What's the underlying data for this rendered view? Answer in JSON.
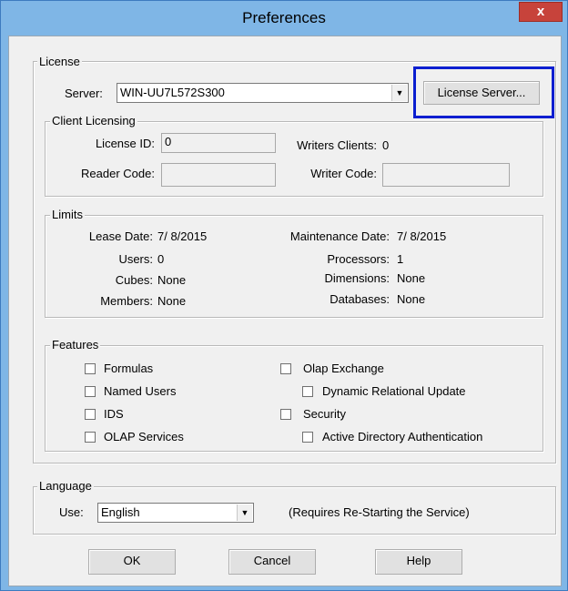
{
  "window": {
    "title": "Preferences",
    "close_label": "x"
  },
  "license": {
    "legend": "License",
    "server_label": "Server:",
    "server_value": "WIN-UU7L572S300",
    "license_server_button": "License Server..."
  },
  "client_licensing": {
    "legend": "Client Licensing",
    "license_id_label": "License ID:",
    "license_id_value": "0",
    "writers_clients_label": "Writers Clients:",
    "writers_clients_value": "0",
    "reader_code_label": "Reader Code:",
    "reader_code_value": "",
    "writer_code_label": "Writer Code:",
    "writer_code_value": ""
  },
  "limits": {
    "legend": "Limits",
    "lease_date_label": "Lease Date:",
    "lease_date_value": "7/ 8/2015",
    "maintenance_date_label": "Maintenance Date:",
    "maintenance_date_value": "7/ 8/2015",
    "users_label": "Users:",
    "users_value": "0",
    "processors_label": "Processors:",
    "processors_value": "1",
    "cubes_label": "Cubes:",
    "cubes_value": "None",
    "dimensions_label": "Dimensions:",
    "dimensions_value": "None",
    "members_label": "Members:",
    "members_value": "None",
    "databases_label": "Databases:",
    "databases_value": "None"
  },
  "features": {
    "legend": "Features",
    "formulas": "Formulas",
    "named_users": "Named Users",
    "ids": "IDS",
    "olap_services": "OLAP Services",
    "olap_exchange": "Olap Exchange",
    "dynamic_relational_update": "Dynamic Relational Update",
    "security": "Security",
    "active_directory_authentication": "Active Directory Authentication"
  },
  "language": {
    "legend": "Language",
    "use_label": "Use:",
    "use_value": "English",
    "note": "(Requires Re-Starting the Service)"
  },
  "buttons": {
    "ok": "OK",
    "cancel": "Cancel",
    "help": "Help"
  },
  "colors": {
    "titlebar": "#7fb6e6",
    "close": "#c7433b",
    "highlight": "#0a1ed0"
  }
}
